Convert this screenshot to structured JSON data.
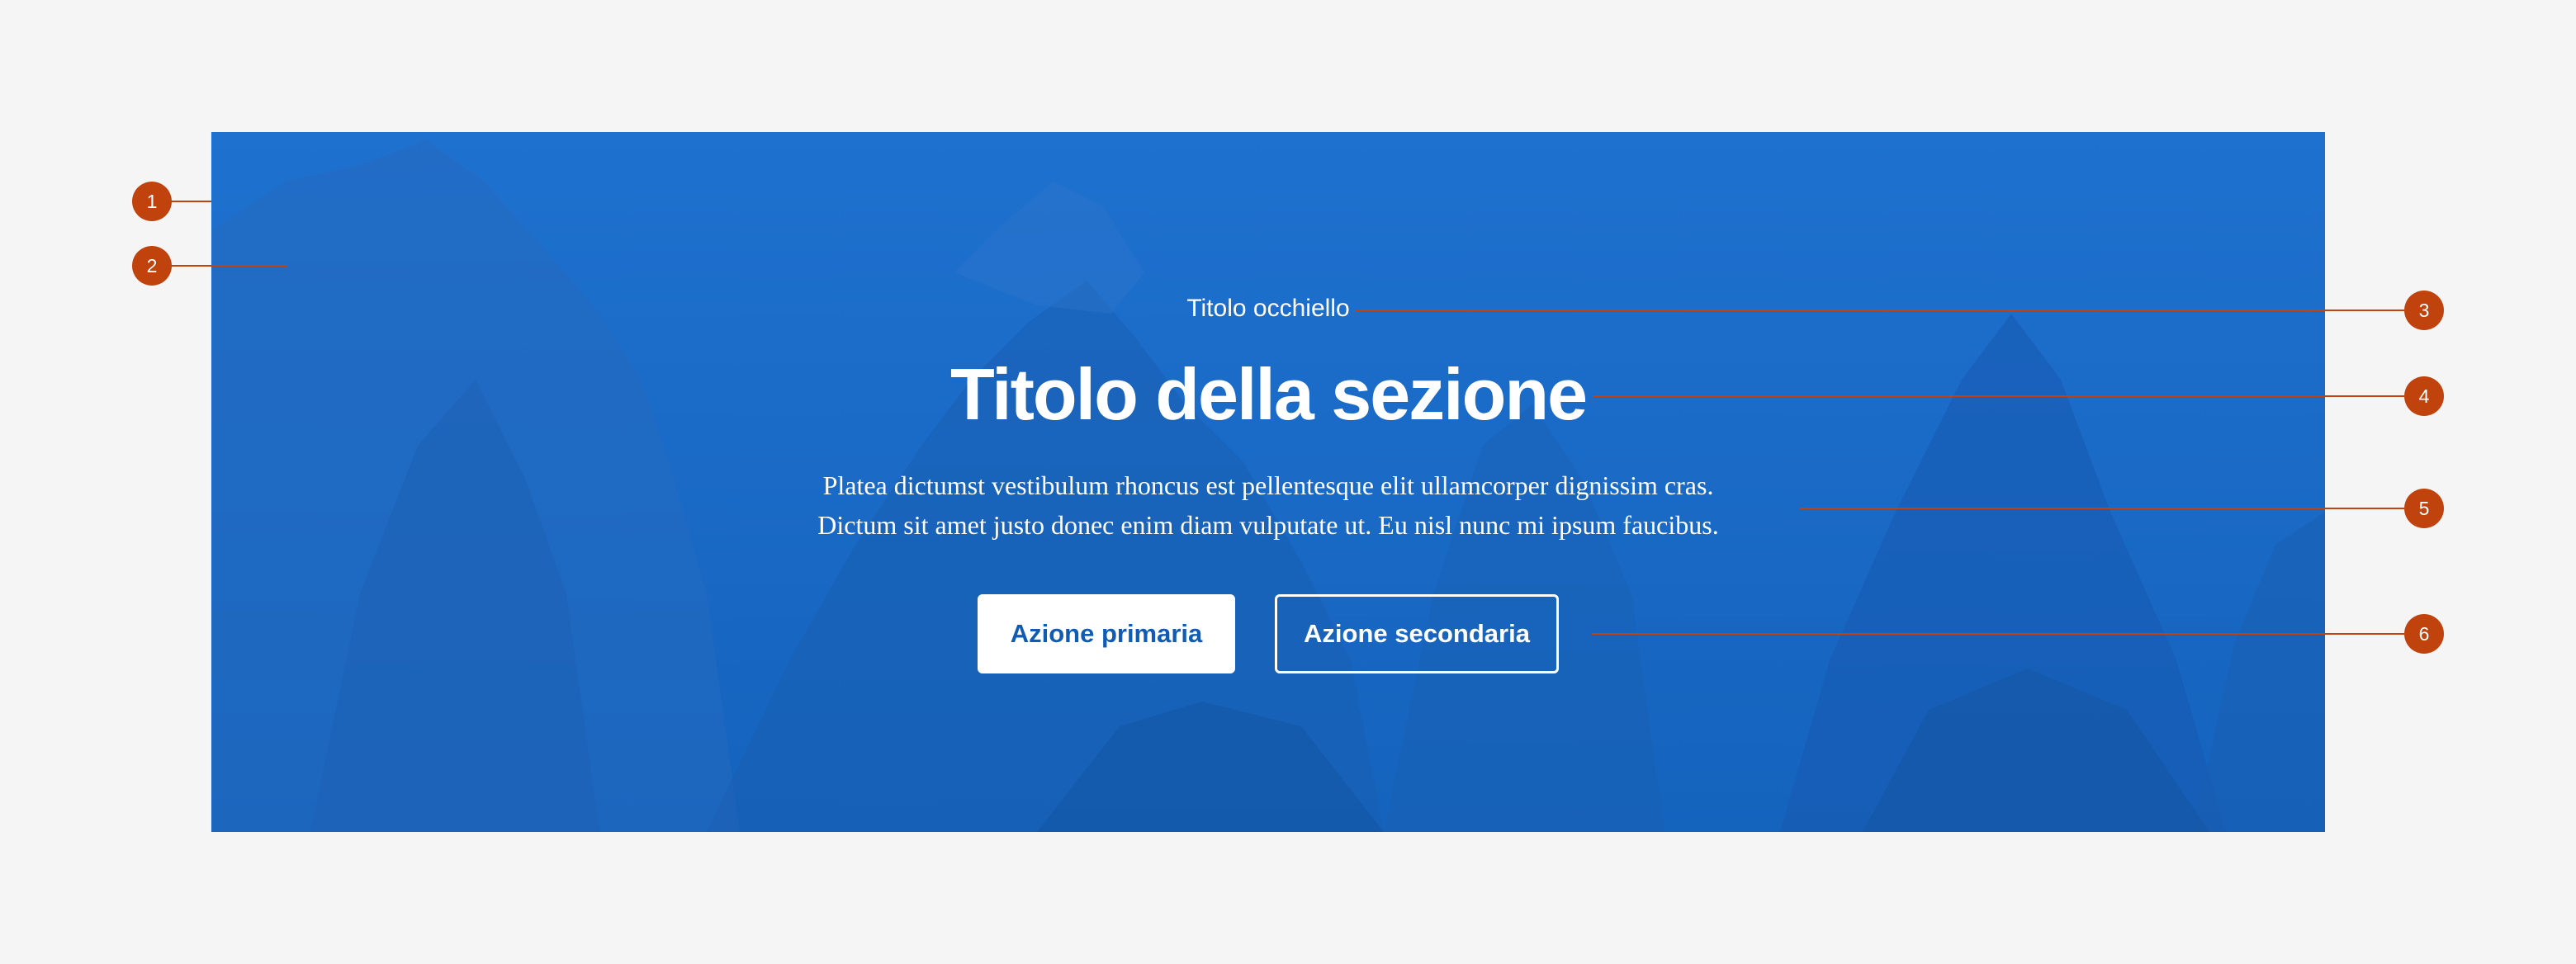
{
  "hero": {
    "kicker": "Titolo occhiello",
    "title": "Titolo della sezione",
    "lead_lines": [
      "Platea dictumst vestibulum rhoncus est pellentesque elit ullamcorper dignissim cras.",
      "Dictum sit amet justo donec enim diam vulputate ut. Eu nisl nunc mi ipsum faucibus."
    ],
    "primary_button": "Azione primaria",
    "secondary_button": "Azione secondaria",
    "background_image": "mountain-landscape",
    "overlay_color": "#1a68c4"
  },
  "annotations": {
    "markers": [
      "1",
      "2",
      "3",
      "4",
      "5",
      "6"
    ],
    "color": "#c0430e"
  },
  "page_background": "#f5f5f5"
}
